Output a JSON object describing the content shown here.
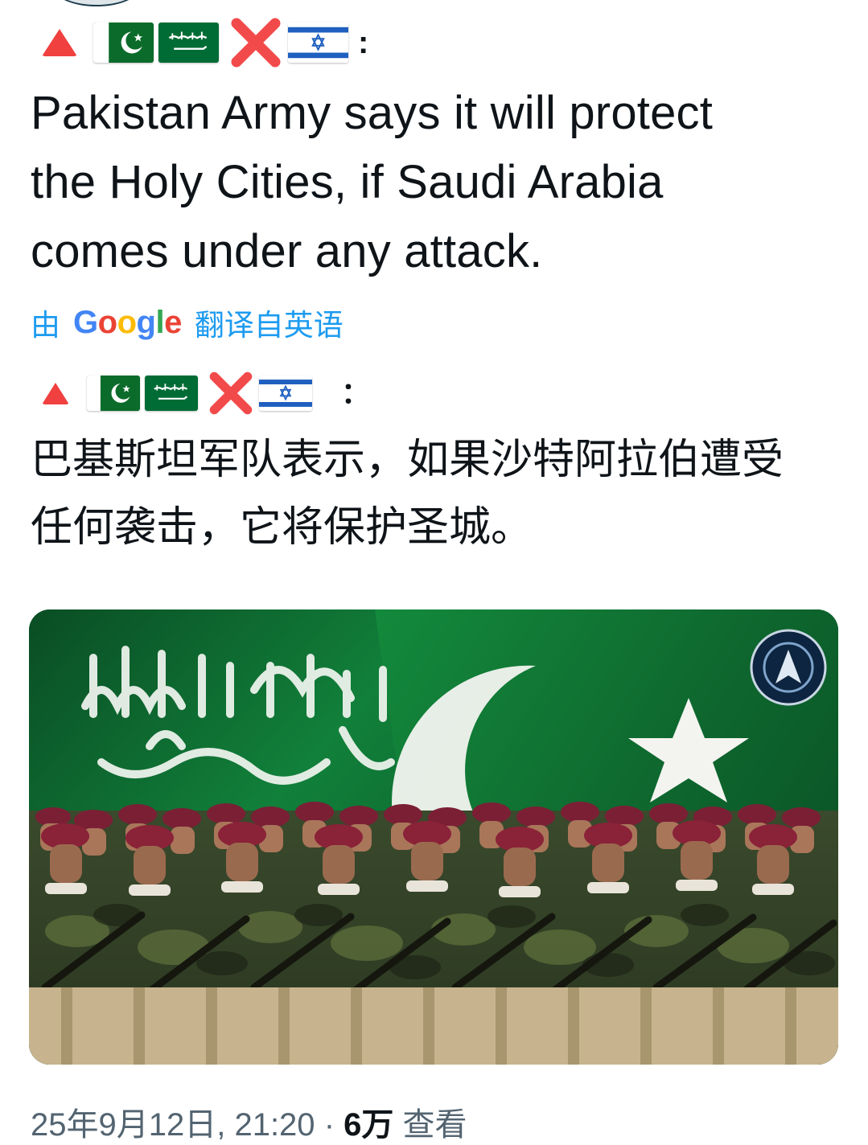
{
  "post": {
    "text_lines": [
      "Pakistan Army says it will protect",
      "the Holy Cities, if Saudi Arabia",
      "comes under any attack."
    ],
    "prefix_colon": ":",
    "translation": {
      "by": "由",
      "provider": "Google",
      "from": "翻译自英语",
      "text_lines": [
        "巴基斯坦军队表示，如果沙特阿拉伯遭受",
        "任何袭击，它将保护圣城。"
      ],
      "prefix_colon": "："
    },
    "emoji_prefix": [
      "red-triangle",
      "pakistan-flag",
      "saudi-flag",
      "cross-mark",
      "israel-flag"
    ],
    "image": {
      "description_icons": [
        "saudi-flag-background",
        "pakistan-flag-background",
        "soldiers-marching",
        "emblem-icon"
      ]
    },
    "meta": {
      "timestamp": "25年9月12日, 21:20",
      "separator": "·",
      "views_count": "6万",
      "views_label": "查看"
    }
  },
  "colors": {
    "link": "#1d9bf0",
    "secondary": "#536471",
    "text": "#0f1419",
    "google_blue": "#4285f4",
    "google_red": "#ea4335",
    "google_yellow": "#fbbc05",
    "google_green": "#34a853"
  }
}
